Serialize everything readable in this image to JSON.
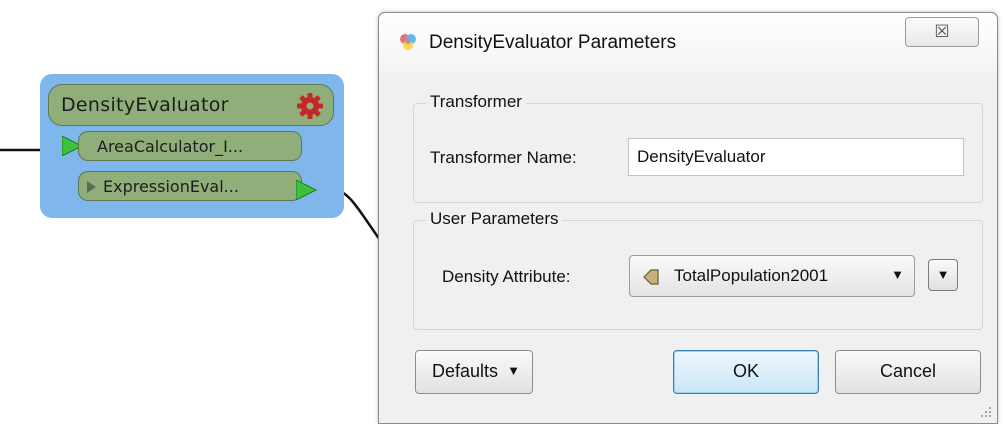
{
  "workspace": {
    "transformer": {
      "title": "DensityEvaluator",
      "input_port": "AreaCalculator_I...",
      "output_port": "ExpressionEval..."
    }
  },
  "dialog": {
    "title": "DensityEvaluator Parameters",
    "close_glyph": "☒",
    "groups": {
      "transformer": {
        "title": "Transformer",
        "name_label": "Transformer Name:",
        "name_value": "DensityEvaluator"
      },
      "user_parameters": {
        "title": "User Parameters",
        "density_label": "Density Attribute:",
        "density_value": "TotalPopulation2001",
        "dropdown_arrow": "▼",
        "extra_button_arrow": "▼"
      }
    },
    "buttons": {
      "defaults": "Defaults",
      "defaults_arrow": "▼",
      "ok": "OK",
      "cancel": "Cancel"
    }
  },
  "colors": {
    "node_background": "#7fb7ec",
    "port_fill": "#8fae7a",
    "port_arrow": "#3ec23e",
    "gear": "#c62828",
    "ok_button": "#c9e5f7"
  },
  "icons": {
    "gear": "gear-icon",
    "app": "fme-app-icon",
    "attribute": "attribute-icon",
    "close": "close-icon"
  }
}
